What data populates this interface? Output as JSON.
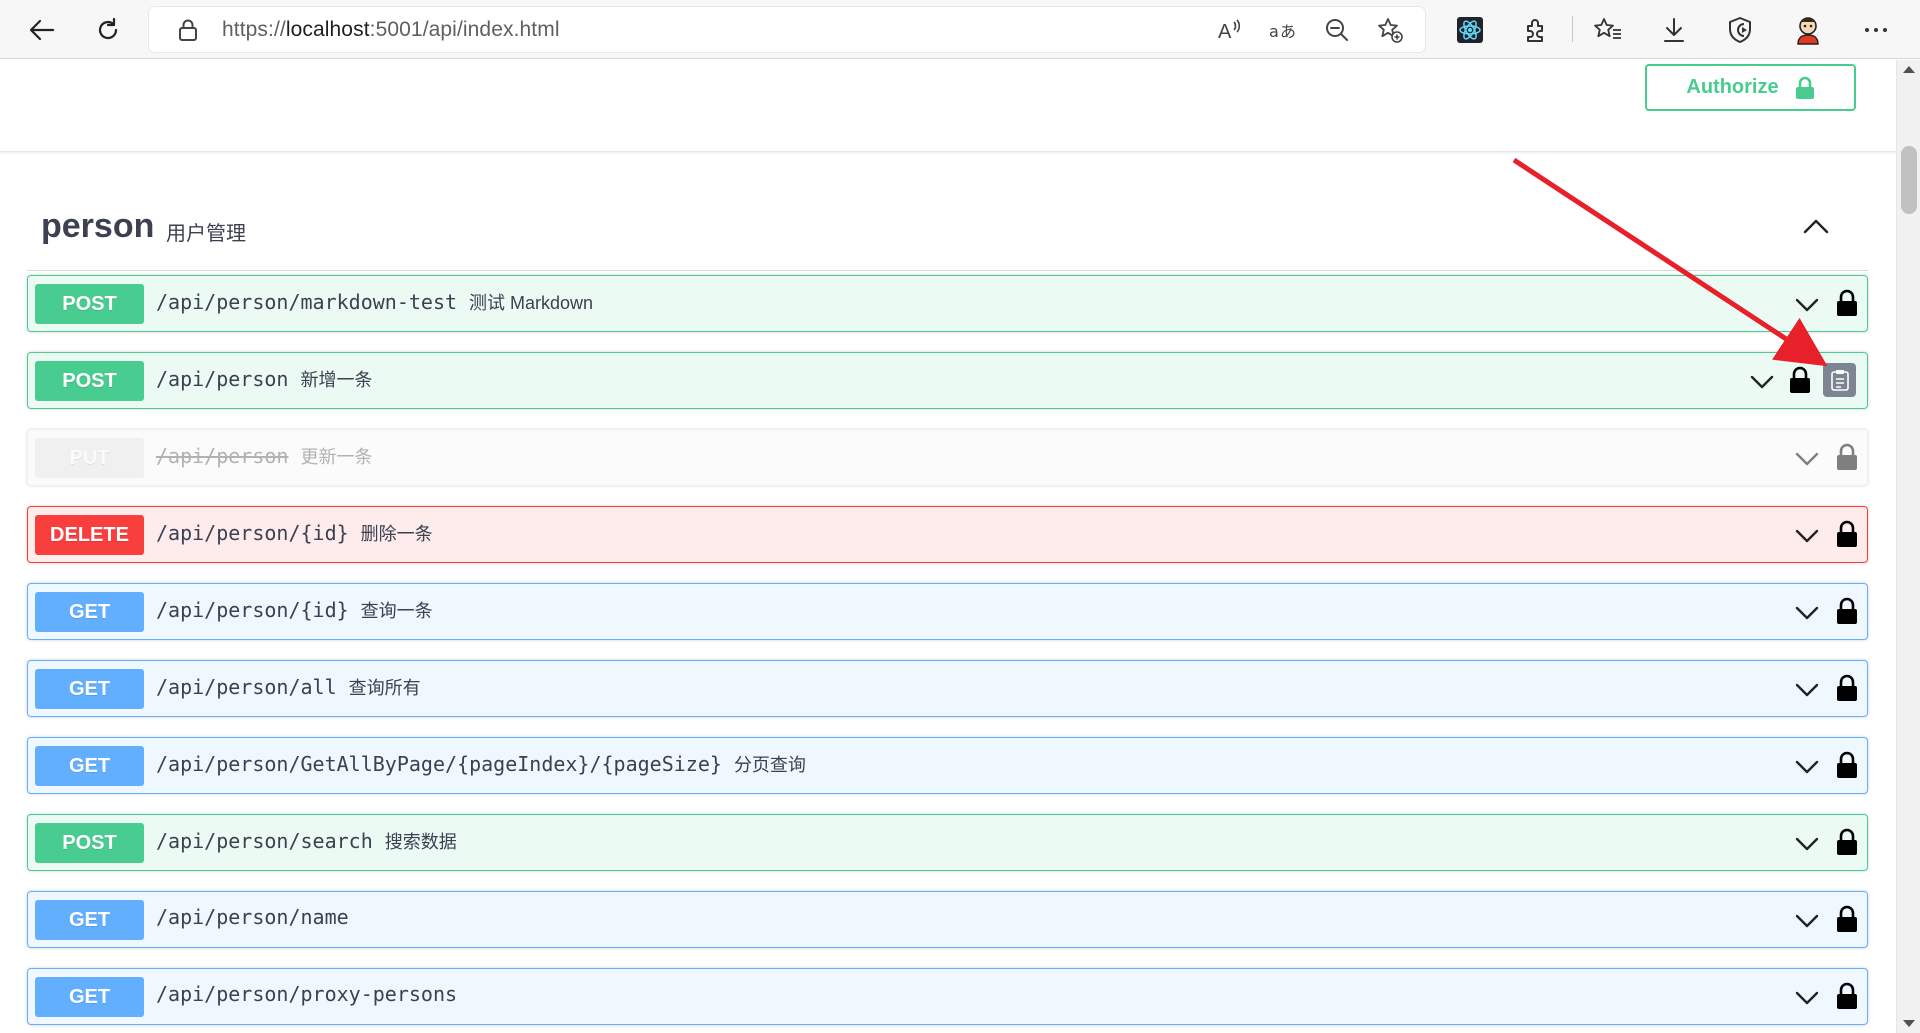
{
  "browser": {
    "url_prefix": "https://",
    "url_host": "localhost",
    "url_rest": ":5001/api/index.html",
    "back_icon": "arrow-left-icon",
    "refresh_icon": "refresh-icon",
    "more_icon": "ellipsis-icon"
  },
  "authorize": {
    "label": "Authorize"
  },
  "tag": {
    "name": "person",
    "description": "用户管理"
  },
  "operations": [
    {
      "method": "POST",
      "path": "/api/person/markdown-test",
      "summary": "测试 Markdown"
    },
    {
      "method": "POST",
      "path": "/api/person",
      "summary": "新增一条"
    },
    {
      "method": "PUT",
      "path": "/api/person",
      "summary": "更新一条"
    },
    {
      "method": "DELETE",
      "path": "/api/person/{id}",
      "summary": "删除一条"
    },
    {
      "method": "GET",
      "path": "/api/person/{id}",
      "summary": "查询一条"
    },
    {
      "method": "GET",
      "path": "/api/person/all",
      "summary": "查询所有"
    },
    {
      "method": "GET",
      "path": "/api/person/GetAllByPage/{pageIndex}/{pageSize}",
      "summary": "分页查询"
    },
    {
      "method": "POST",
      "path": "/api/person/search",
      "summary": "搜索数据"
    },
    {
      "method": "GET",
      "path": "/api/person/name",
      "summary": ""
    },
    {
      "method": "GET",
      "path": "/api/person/proxy-persons",
      "summary": ""
    }
  ],
  "colors": {
    "post": "#49cc90",
    "get": "#61affe",
    "delete": "#f93e3e",
    "put_deprecated": "#ebebeb",
    "annotation_arrow": "#e8202a"
  }
}
